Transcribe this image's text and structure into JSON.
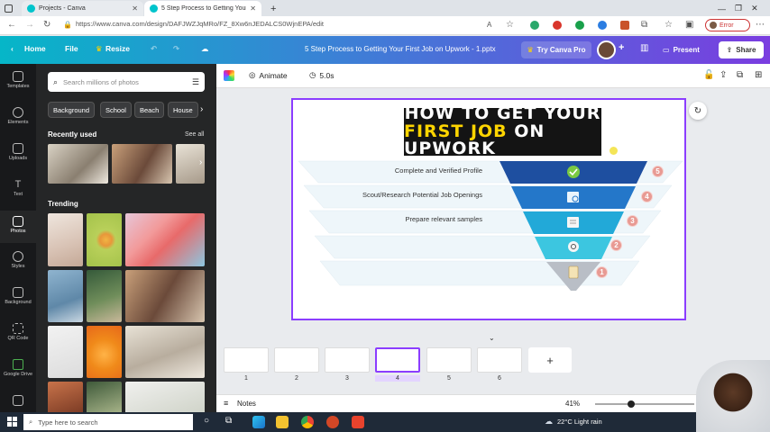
{
  "browser": {
    "tabs": [
      {
        "label": "Projects - Canva",
        "active": false
      },
      {
        "label": "5 Step Process to Getting Your Fi",
        "active": true
      }
    ],
    "url": "https://www.canva.com/design/DAFJWZJqMRo/FZ_8Xw6nJEDALCS0WjnEPA/edit",
    "error_label": "Error"
  },
  "header": {
    "home": "Home",
    "file": "File",
    "resize": "Resize",
    "doc_title": "5 Step Process to Getting  Your First Job on Upwork - 1.pptx",
    "try_pro": "Try Canva Pro",
    "present": "Present",
    "share": "Share"
  },
  "rail": {
    "items": [
      {
        "label": "Templates"
      },
      {
        "label": "Elements"
      },
      {
        "label": "Uploads"
      },
      {
        "label": "Text"
      },
      {
        "label": "Photos"
      },
      {
        "label": "Styles"
      },
      {
        "label": "Background"
      },
      {
        "label": "QR Code"
      },
      {
        "label": "Google Drive"
      }
    ]
  },
  "panel": {
    "search_placeholder": "Search millions of photos",
    "chips": [
      "Background",
      "School",
      "Beach",
      "House"
    ],
    "recently_used": "Recently used",
    "see_all": "See all",
    "trending": "Trending"
  },
  "toolbar": {
    "animate": "Animate",
    "duration": "5.0s"
  },
  "slide": {
    "title_line1": "HOW TO GET YOUR",
    "title_line2_yellow": "FIRST JOB",
    "title_line2_white": " ON UPWORK",
    "rows": [
      {
        "label": "Complete and Verified Profile",
        "number": "5",
        "color": "#1e4fa0"
      },
      {
        "label": "Scout/Research Potential Job Openings",
        "number": "4",
        "color": "#2477c9"
      },
      {
        "label": "Prepare relevant samples",
        "number": "3",
        "color": "#22a9d8"
      },
      {
        "label": "",
        "number": "2",
        "color": "#3cc6e0"
      },
      {
        "label": "",
        "number": "1",
        "color": "#b9bec6"
      }
    ]
  },
  "thumbnails": {
    "pages": [
      "1",
      "2",
      "3",
      "4",
      "5",
      "6"
    ],
    "selected": "4",
    "add": "+"
  },
  "bottom": {
    "notes": "Notes",
    "zoom": "41%"
  },
  "taskbar": {
    "search_placeholder": "Type here to search",
    "weather": "22°C  Light rain"
  }
}
